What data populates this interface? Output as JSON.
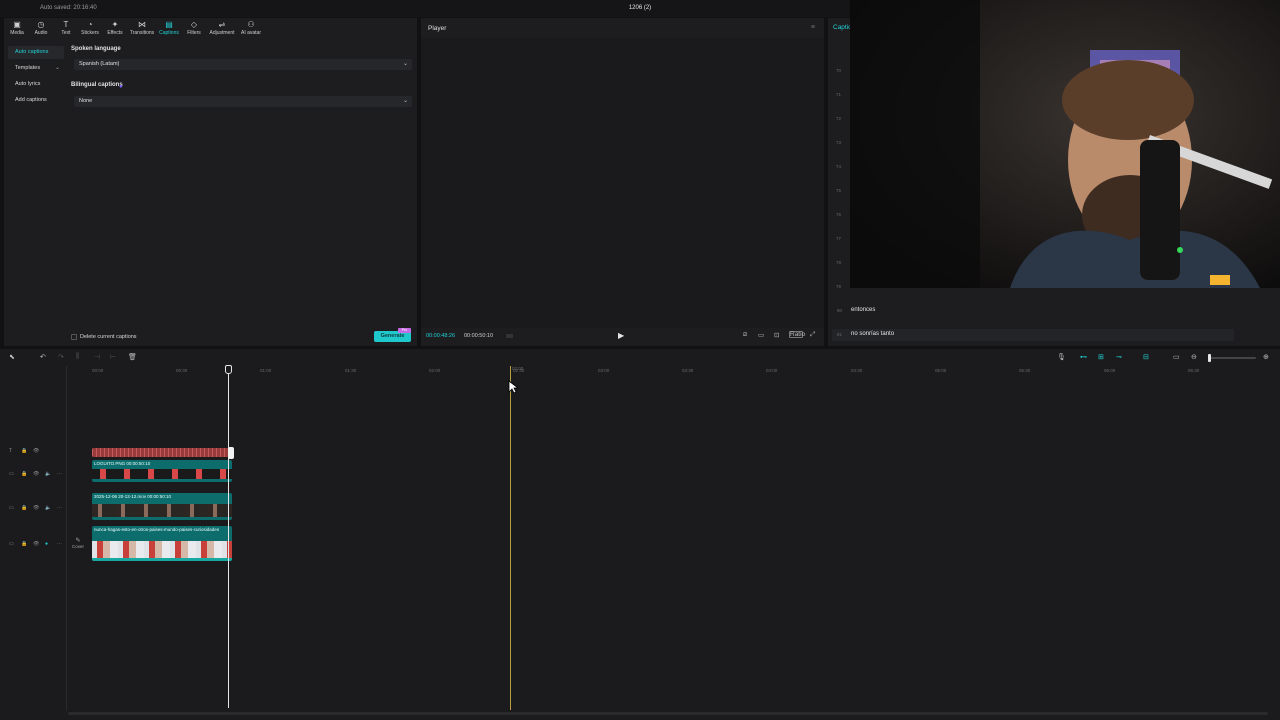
{
  "app": {
    "autosave": "Auto saved: 20:16:40",
    "project_name": "1206 (2)"
  },
  "toolbar": {
    "tabs": [
      {
        "label": "Media",
        "icon": "media-icon"
      },
      {
        "label": "Audio",
        "icon": "audio-icon"
      },
      {
        "label": "Text",
        "icon": "text-icon"
      },
      {
        "label": "Stickers",
        "icon": "stickers-icon"
      },
      {
        "label": "Effects",
        "icon": "effects-icon"
      },
      {
        "label": "Transitions",
        "icon": "transitions-icon"
      },
      {
        "label": "Captions",
        "icon": "captions-icon",
        "active": true
      },
      {
        "label": "Filters",
        "icon": "filters-icon"
      },
      {
        "label": "Adjustment",
        "icon": "adjustment-icon"
      },
      {
        "label": "AI avatar",
        "icon": "ai-avatar-icon"
      }
    ]
  },
  "sidenav": {
    "items": [
      {
        "label": "Auto captions",
        "active": true
      },
      {
        "label": "Templates"
      },
      {
        "label": "Auto lyrics"
      },
      {
        "label": "Add captions"
      }
    ]
  },
  "captions_form": {
    "spoken_language_label": "Spoken language",
    "spoken_language_value": "Spanish (Latam)",
    "bilingual_label": "Bilingual captions",
    "bilingual_value": "None",
    "delete_label": "Delete current captions",
    "generate_label": "Generate",
    "pro_badge": "Pro"
  },
  "player": {
    "title": "Player",
    "current_time": "00:00:48:26",
    "total_time": "00:00:50:10",
    "ratio_label": "Ratio"
  },
  "captions_panel": {
    "tab_label": "Captio",
    "list_numbers": [
      "70",
      "71",
      "72",
      "73",
      "74",
      "75",
      "76",
      "77",
      "78",
      "79"
    ],
    "rows": [
      {
        "num": "80",
        "text": "entonces",
        "active": false
      },
      {
        "num": "81",
        "text": "no sonrías tanto",
        "active": true
      }
    ]
  },
  "timeline": {
    "ruler_labels": [
      "00:00",
      "00:30",
      "01:00",
      "01:30",
      "02:00",
      "02:30",
      "03:00",
      "03:30",
      "04:00",
      "04:30",
      "05:00",
      "05:30",
      "06:00",
      "06:30",
      "07:00"
    ],
    "hover_time": "02:00",
    "clips": {
      "logo": "LOGUITO.PNG  00:00:50:10",
      "video": "2025-12-06 20-12-12.mov  00:00:50:10",
      "main": "nunca-hagas-esto-en-otros-paises-mundo-paises-curiosidades"
    },
    "cover_label": "Cover"
  },
  "colors": {
    "accent": "#22d3d6",
    "clip_teal": "#0d6d6d",
    "text_clip": "#9a3b3b",
    "hover_line": "#b8a040"
  }
}
